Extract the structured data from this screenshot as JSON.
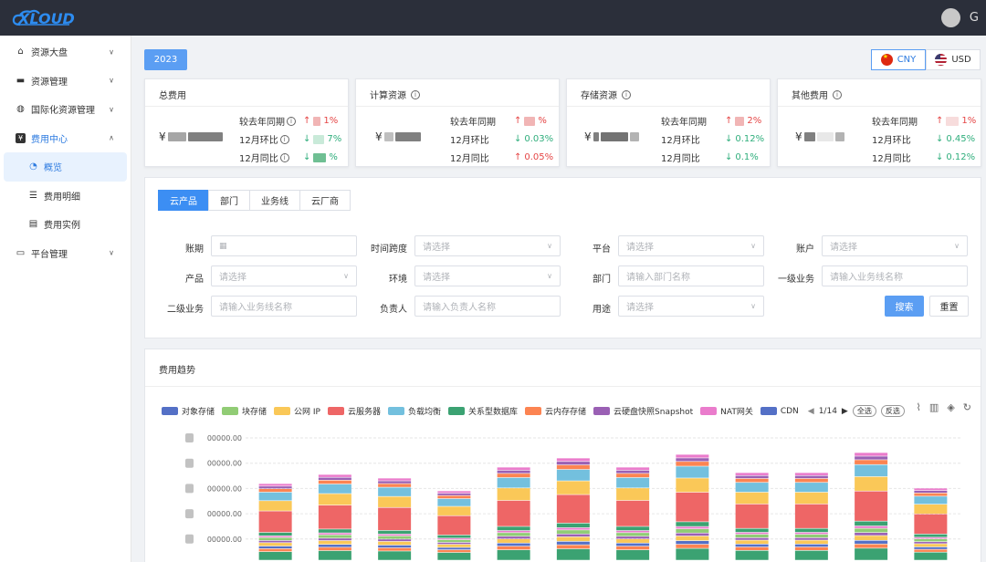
{
  "topbar": {
    "logo_text": "XLOUD",
    "exit_icon": "G"
  },
  "sidebar": {
    "items": [
      {
        "label": "资源大盘",
        "icon": "home-icon",
        "glyph": "⌂",
        "chevron": "∨"
      },
      {
        "label": "资源管理",
        "icon": "folder-icon",
        "glyph": "▬",
        "chevron": "∨"
      },
      {
        "label": "国际化资源管理",
        "icon": "globe-icon",
        "glyph": "◍",
        "chevron": "∨"
      },
      {
        "label": "费用中心",
        "icon": "yen-icon",
        "glyph": "¥",
        "chevron": "∧"
      },
      {
        "label": "概览",
        "icon": "pie-chart-icon",
        "glyph": "◔",
        "sub": true,
        "active": true
      },
      {
        "label": "费用明细",
        "icon": "list-icon",
        "glyph": "☰",
        "sub": true
      },
      {
        "label": "费用实例",
        "icon": "doc-icon",
        "glyph": "▤",
        "sub": true
      },
      {
        "label": "平台管理",
        "icon": "monitor-icon",
        "glyph": "▭",
        "chevron": "∨"
      }
    ]
  },
  "header": {
    "year": "2023",
    "currencies": [
      {
        "code": "CNY",
        "active": true
      },
      {
        "code": "USD",
        "active": false
      }
    ]
  },
  "cards": [
    {
      "title": "总费用",
      "has_info": false,
      "amount_prefix": "¥",
      "stats": [
        {
          "label": "较去年同期",
          "info": true,
          "dir": "↑",
          "value": "1%"
        },
        {
          "label": "12月环比",
          "info": true,
          "dir": "↓",
          "value": "7%"
        },
        {
          "label": "12月同比",
          "info": true,
          "dir": "↓",
          "value": "%"
        }
      ]
    },
    {
      "title": "计算资源",
      "has_info": true,
      "amount_prefix": "¥",
      "stats": [
        {
          "label": "较去年同期",
          "info": false,
          "dir": "↑",
          "value": "%"
        },
        {
          "label": "12月环比",
          "info": false,
          "dir": "↓",
          "value": "0.03%"
        },
        {
          "label": "12月同比",
          "info": false,
          "dir": "↑",
          "value": "0.05%"
        }
      ]
    },
    {
      "title": "存储资源",
      "has_info": true,
      "amount_prefix": "¥",
      "stats": [
        {
          "label": "较去年同期",
          "info": false,
          "dir": "↑",
          "value": "2%"
        },
        {
          "label": "12月环比",
          "info": false,
          "dir": "↓",
          "value": "0.12%"
        },
        {
          "label": "12月同比",
          "info": false,
          "dir": "↓",
          "value": "0.1%"
        }
      ]
    },
    {
      "title": "其他费用",
      "has_info": true,
      "amount_prefix": "¥",
      "stats": [
        {
          "label": "较去年同期",
          "info": false,
          "dir": "↑",
          "value": "1%"
        },
        {
          "label": "12月环比",
          "info": false,
          "dir": "↓",
          "value": "0.45%"
        },
        {
          "label": "12月同比",
          "info": false,
          "dir": "↓",
          "value": "0.12%"
        }
      ]
    }
  ],
  "filters": {
    "tabs": [
      "云产品",
      "部门",
      "业务线",
      "云厂商"
    ],
    "fields": [
      {
        "label": "账期",
        "placeholder": "",
        "type": "date"
      },
      {
        "label": "时间跨度",
        "placeholder": "请选择",
        "type": "select"
      },
      {
        "label": "平台",
        "placeholder": "请选择",
        "type": "select"
      },
      {
        "label": "账户",
        "placeholder": "请选择",
        "type": "select"
      },
      {
        "label": "产品",
        "placeholder": "请选择",
        "type": "select"
      },
      {
        "label": "环境",
        "placeholder": "请选择",
        "type": "select"
      },
      {
        "label": "部门",
        "placeholder": "请输入部门名称",
        "type": "input"
      },
      {
        "label": "一级业务",
        "placeholder": "请输入业务线名称",
        "type": "input"
      },
      {
        "label": "二级业务",
        "placeholder": "请输入业务线名称",
        "type": "input"
      },
      {
        "label": "负责人",
        "placeholder": "请输入负责人名称",
        "type": "input"
      },
      {
        "label": "用途",
        "placeholder": "请选择",
        "type": "select"
      }
    ],
    "search_label": "搜索",
    "reset_label": "重置"
  },
  "chart_panel": {
    "title": "费用趋势",
    "legend_page": "1/14",
    "select_all": "全选",
    "invert": "反选"
  },
  "chart_data": {
    "type": "bar",
    "stacked": true,
    "y_tick_labels": [
      "00000.00",
      "00000.00",
      "00000.00",
      "00000.00",
      "00000.00"
    ],
    "series": [
      {
        "name": "对象存储",
        "color": "#5470c6"
      },
      {
        "name": "块存储",
        "color": "#91cc75"
      },
      {
        "name": "公网 IP",
        "color": "#fac858"
      },
      {
        "name": "云服务器",
        "color": "#ee6666"
      },
      {
        "name": "负载均衡",
        "color": "#73c0de"
      },
      {
        "name": "关系型数据库",
        "color": "#3ba272"
      },
      {
        "name": "云内存存储",
        "color": "#fc8452"
      },
      {
        "name": "云硬盘快照Snapshot",
        "color": "#9a60b4"
      },
      {
        "name": "NAT网关",
        "color": "#ea7ccc"
      },
      {
        "name": "CDN",
        "color": "#5470c6"
      }
    ],
    "bar_heights": [
      0.84,
      0.94,
      0.9,
      0.76,
      1.02,
      1.12,
      1.02,
      1.16,
      0.96,
      0.96,
      1.18,
      0.79
    ],
    "stack_profile": [
      {
        "color": "#3ba272",
        "h": 0.1
      },
      {
        "color": "#fc8452",
        "h": 0.035
      },
      {
        "color": "#5470c6",
        "h": 0.03
      },
      {
        "color": "#fac858",
        "h": 0.04
      },
      {
        "color": "#9a60b4",
        "h": 0.025
      },
      {
        "color": "#91cc75",
        "h": 0.035
      },
      {
        "color": "#ea7ccc",
        "h": 0.02
      },
      {
        "color": "#3ba272",
        "h": 0.04
      },
      {
        "color": "#ee6666",
        "h": 0.25
      },
      {
        "color": "#fac858",
        "h": 0.12
      },
      {
        "color": "#73c0de",
        "h": 0.1
      },
      {
        "color": "#fc8452",
        "h": 0.04
      },
      {
        "color": "#9a60b4",
        "h": 0.03
      },
      {
        "color": "#ea7ccc",
        "h": 0.03
      }
    ]
  }
}
